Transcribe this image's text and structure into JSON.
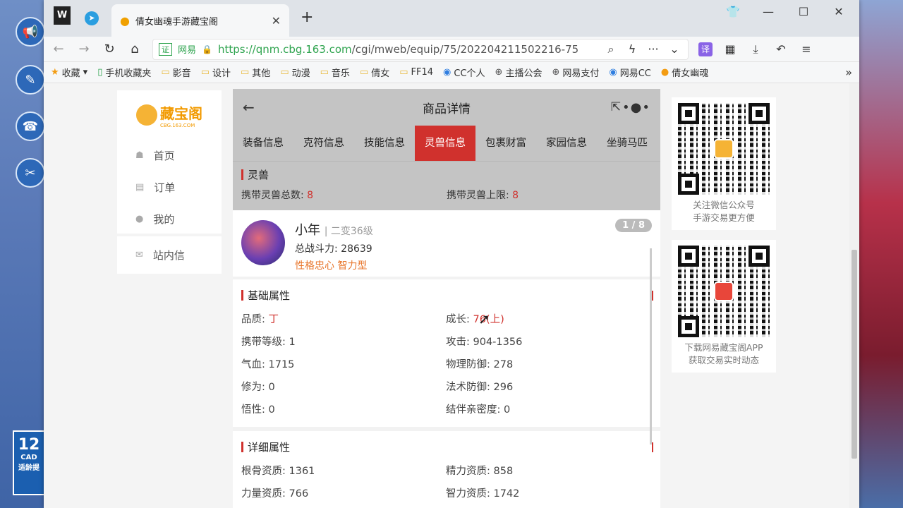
{
  "desktop": {
    "cad_label": "12",
    "cad_sub": "CAD",
    "cad_caption": "适龄提"
  },
  "browser": {
    "tab_title": "倩女幽魂手游藏宝阁",
    "url_cert": "证",
    "url_cert_label": "网易",
    "url_host": "https://qnm.cbg.163.com",
    "url_path": "/cgi/mweb/equip/75/202204211502216-75",
    "bookmarks": [
      "收藏",
      "手机收藏夹",
      "影音",
      "设计",
      "其他",
      "动漫",
      "音乐",
      "倩女",
      "FF14",
      "CC个人",
      "主播公会",
      "网易支付",
      "网易CC",
      "倩女幽魂"
    ]
  },
  "leftnav": {
    "brand": "藏宝阁",
    "brand_sub": "CBG.163.COM",
    "items": [
      {
        "label": "首页"
      },
      {
        "label": "订单"
      },
      {
        "label": "我的"
      },
      {
        "label": "站内信"
      }
    ]
  },
  "detail": {
    "page_title": "商品详情",
    "tabs": [
      "装备信息",
      "克符信息",
      "技能信息",
      "灵兽信息",
      "包裹财富",
      "家园信息",
      "坐骑马匹"
    ],
    "active_tab": "灵兽信息",
    "section_title": "灵兽",
    "carry_total_label": "携带灵兽总数:",
    "carry_total_value": "8",
    "carry_limit_label": "携带灵兽上限:",
    "carry_limit_value": "8",
    "pet": {
      "name": "小年",
      "level": "| 二变36级",
      "power": "总战斗力: 28639",
      "traits": "性格忠心  智力型",
      "pager": "1 / 8"
    },
    "basic_title": "基础属性",
    "basic_attrs": [
      {
        "label": "品质: ",
        "value": "丁"
      },
      {
        "label": "成长: ",
        "value": "76(上)"
      },
      {
        "label": "携带等级: ",
        "value": "1"
      },
      {
        "label": "攻击: ",
        "value": "904-1356"
      },
      {
        "label": "气血: ",
        "value": "1715"
      },
      {
        "label": "物理防御: ",
        "value": "278"
      },
      {
        "label": "修为: ",
        "value": "0"
      },
      {
        "label": "法术防御: ",
        "value": "296"
      },
      {
        "label": "悟性: ",
        "value": "0"
      },
      {
        "label": "结伴亲密度: ",
        "value": "0"
      }
    ],
    "detail_title": "详细属性",
    "detail_attrs": [
      {
        "label": "根骨资质: ",
        "value": "1361"
      },
      {
        "label": "精力资质: ",
        "value": "858"
      },
      {
        "label": "力量资质: ",
        "value": "766"
      },
      {
        "label": "智力资质: ",
        "value": "1742"
      }
    ]
  },
  "qr": {
    "wechat_line1": "关注微信公众号",
    "wechat_line2": "手游交易更方便",
    "app_line1": "下载网易藏宝阁APP",
    "app_line2": "获取交易实时动态"
  },
  "colors": {
    "accent_red": "#d0312d",
    "header_gray": "#c4c4c4",
    "url_green": "#2fa44f",
    "trait_orange": "#e8762c"
  }
}
